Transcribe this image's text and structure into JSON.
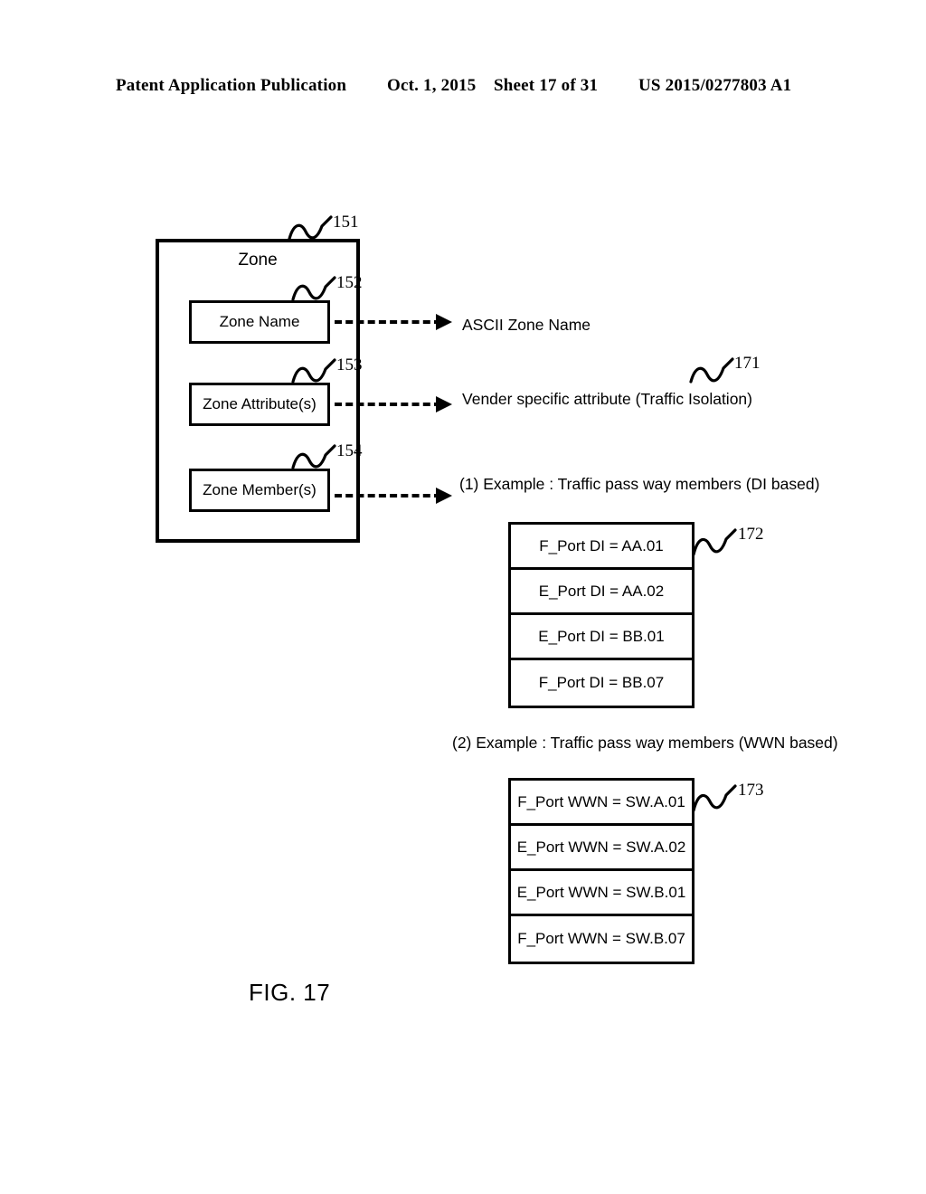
{
  "header": {
    "publication": "Patent Application Publication",
    "date": "Oct. 1, 2015",
    "sheet": "Sheet 17 of 31",
    "number": "US 2015/0277803 A1"
  },
  "figure": {
    "caption": "FIG. 17"
  },
  "zone_block": {
    "title": "Zone",
    "ref": "151",
    "fields": [
      {
        "label": "Zone Name",
        "ref": "152"
      },
      {
        "label": "Zone Attribute(s)",
        "ref": "153"
      },
      {
        "label": "Zone Member(s)",
        "ref": "154"
      }
    ]
  },
  "callouts": {
    "ascii_zone_name": "ASCII Zone Name",
    "vendor_attribute": "Vender specific attribute (Traffic Isolation)",
    "vendor_attribute_ref": "171",
    "example_1": "(1) Example : Traffic pass way members (DI based)",
    "example_2": "(2) Example : Traffic pass way members (WWN based)"
  },
  "table_di": {
    "ref": "172",
    "rows": [
      "F_Port DI = AA.01",
      "E_Port  DI = AA.02",
      "E_Port DI = BB.01",
      "F_Port DI = BB.07"
    ]
  },
  "table_wwn": {
    "ref": "173",
    "rows": [
      "F_Port WWN = SW.A.01",
      "E_Port WWN = SW.A.02",
      "E_Port WWN = SW.B.01",
      "F_Port WWN = SW.B.07"
    ]
  }
}
